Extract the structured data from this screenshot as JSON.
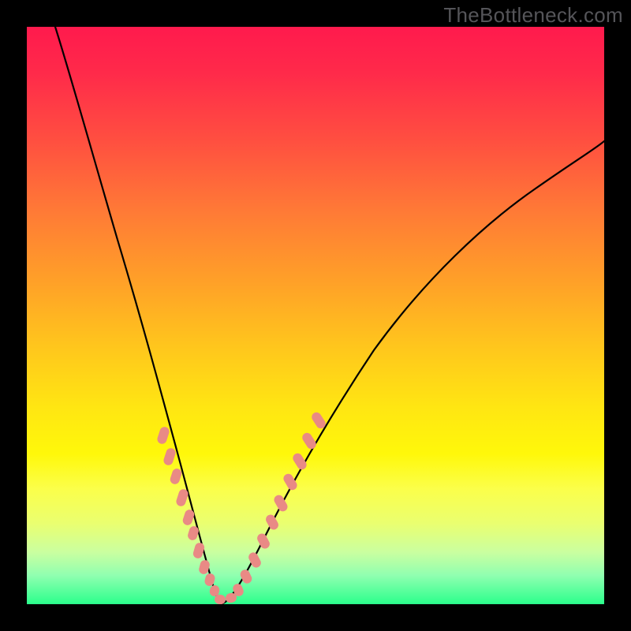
{
  "watermark": {
    "text": "TheBottleneck.com"
  },
  "chart_data": {
    "type": "line",
    "title": "",
    "xlabel": "",
    "ylabel": "",
    "xlim": [
      0,
      100
    ],
    "ylim": [
      0,
      100
    ],
    "grid": false,
    "legend": false,
    "background_gradient": {
      "top": "#ff1a4d",
      "bottom": "#2bff8c",
      "note": "vertical red→yellow→green gradient"
    },
    "series": [
      {
        "name": "left-curve",
        "x": [
          5,
          8,
          12,
          16,
          20,
          22,
          24,
          26,
          28,
          30,
          31,
          32,
          33
        ],
        "y": [
          100,
          90,
          76,
          62,
          44,
          35,
          27,
          20,
          14,
          8,
          5,
          2.5,
          1
        ]
      },
      {
        "name": "right-curve",
        "x": [
          33,
          35,
          38,
          42,
          48,
          55,
          63,
          72,
          82,
          92,
          100
        ],
        "y": [
          1,
          4,
          10,
          20,
          33,
          46,
          57,
          66,
          73,
          78,
          81
        ]
      },
      {
        "name": "left-markers",
        "type": "scatter",
        "x": [
          23.5,
          24.8,
          25.8,
          27.0,
          28.0,
          28.8,
          29.8,
          30.6,
          31.4,
          32.2,
          33.0
        ],
        "y": [
          29,
          25,
          22,
          18.5,
          15,
          12.5,
          9.5,
          7,
          4.8,
          2.8,
          1.0
        ]
      },
      {
        "name": "right-markers",
        "type": "scatter",
        "x": [
          33.8,
          34.6,
          35.6,
          36.8,
          38.0,
          39.2,
          40.5,
          42.0,
          43.5,
          45.0,
          46.5
        ],
        "y": [
          1.4,
          2.5,
          4.5,
          7.5,
          10.5,
          14,
          17.5,
          21,
          24.5,
          28,
          31.5
        ]
      }
    ],
    "markers": {
      "color": "#e98a85",
      "shape": "rounded-capsule",
      "note": "clustered along lower portions of both curves"
    }
  }
}
